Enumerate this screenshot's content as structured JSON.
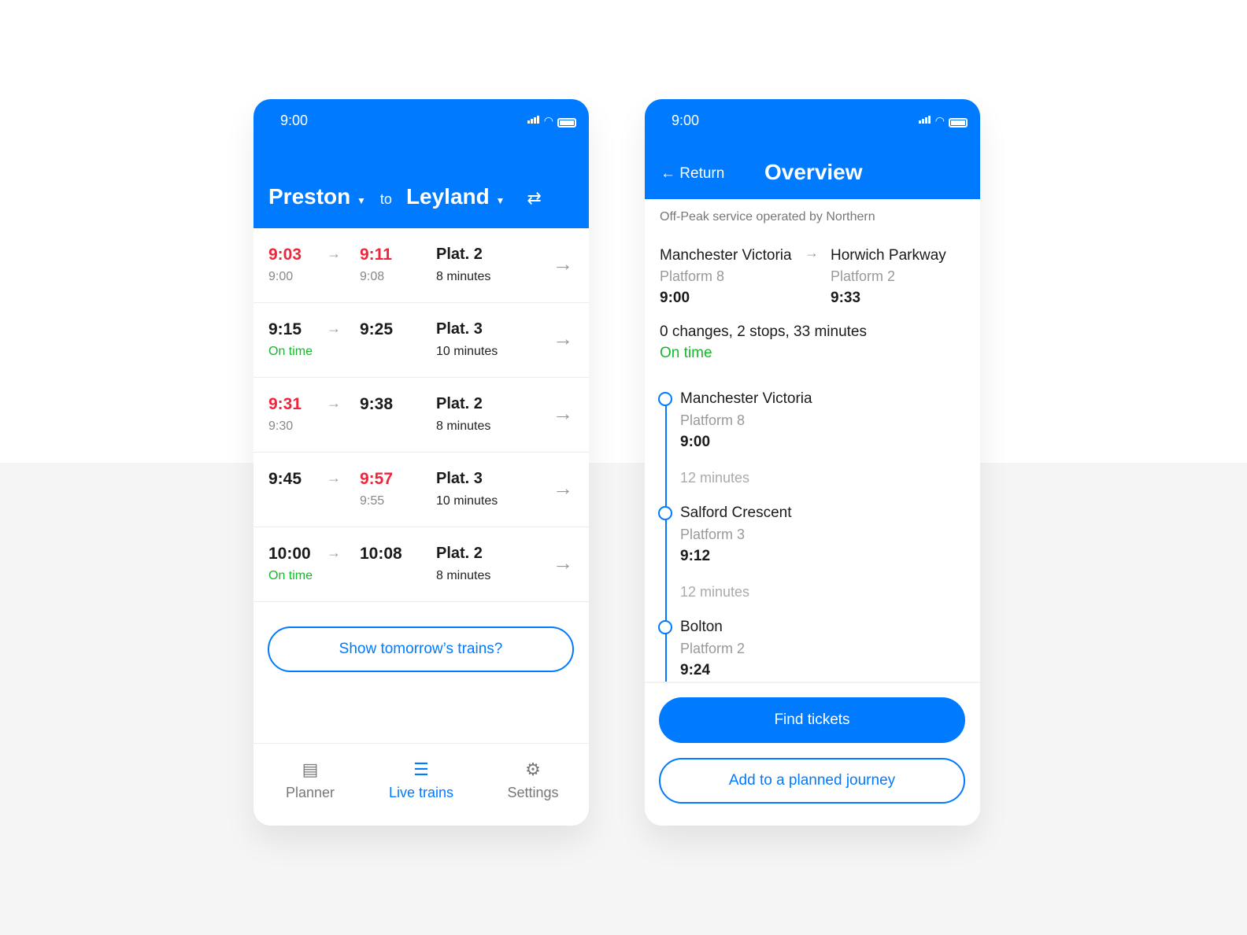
{
  "status": {
    "time": "9:00"
  },
  "left": {
    "from": "Preston",
    "to_word": "to",
    "to": "Leyland",
    "rows": [
      {
        "dep": "9:03",
        "dep_delayed": true,
        "dep_sub": "9:00",
        "arr": "9:11",
        "arr_delayed": true,
        "arr_sub": "9:08",
        "plat": "Plat. 2",
        "dur": "8 minutes"
      },
      {
        "dep": "9:15",
        "dep_delayed": false,
        "dep_sub": "On time",
        "arr": "9:25",
        "arr_delayed": false,
        "arr_sub": "",
        "plat": "Plat. 3",
        "dur": "10 minutes"
      },
      {
        "dep": "9:31",
        "dep_delayed": true,
        "dep_sub": "9:30",
        "arr": "9:38",
        "arr_delayed": false,
        "arr_sub": "",
        "plat": "Plat. 2",
        "dur": "8 minutes"
      },
      {
        "dep": "9:45",
        "dep_delayed": false,
        "dep_sub": "",
        "arr": "9:57",
        "arr_delayed": true,
        "arr_sub": "9:55",
        "plat": "Plat. 3",
        "dur": "10 minutes"
      },
      {
        "dep": "10:00",
        "dep_delayed": false,
        "dep_sub": "On time",
        "arr": "10:08",
        "arr_delayed": false,
        "arr_sub": "",
        "plat": "Plat. 2",
        "dur": "8 minutes"
      }
    ],
    "tomorrow_button": "Show tomorrow’s trains?",
    "tabs": [
      {
        "label": "Planner",
        "icon": "calendar-icon"
      },
      {
        "label": "Live trains",
        "icon": "list-icon",
        "active": true
      },
      {
        "label": "Settings",
        "icon": "gear-icon"
      }
    ]
  },
  "right": {
    "back": "Return",
    "title": "Overview",
    "operator": "Off-Peak service operated by Northern",
    "origin": {
      "name": "Manchester Victoria",
      "platform": "Platform 8",
      "time": "9:00"
    },
    "destination": {
      "name": "Horwich Parkway",
      "platform": "Platform 2",
      "time": "9:33"
    },
    "summary": "0 changes, 2 stops, 33 minutes",
    "status": "On time",
    "stops": [
      {
        "name": "Manchester Victoria",
        "platform": "Platform 8",
        "time": "9:00"
      },
      {
        "name": "Salford Crescent",
        "platform": "Platform 3",
        "time": "9:12"
      },
      {
        "name": "Bolton",
        "platform": "Platform 2",
        "time": "9:24"
      }
    ],
    "durations": [
      "12 minutes",
      "12 minutes"
    ],
    "find_tickets": "Find tickets",
    "add_journey": "Add to a planned journey"
  },
  "colors": {
    "accent": "#007aff",
    "delayed": "#f0243a",
    "on_time": "#14b82a"
  }
}
